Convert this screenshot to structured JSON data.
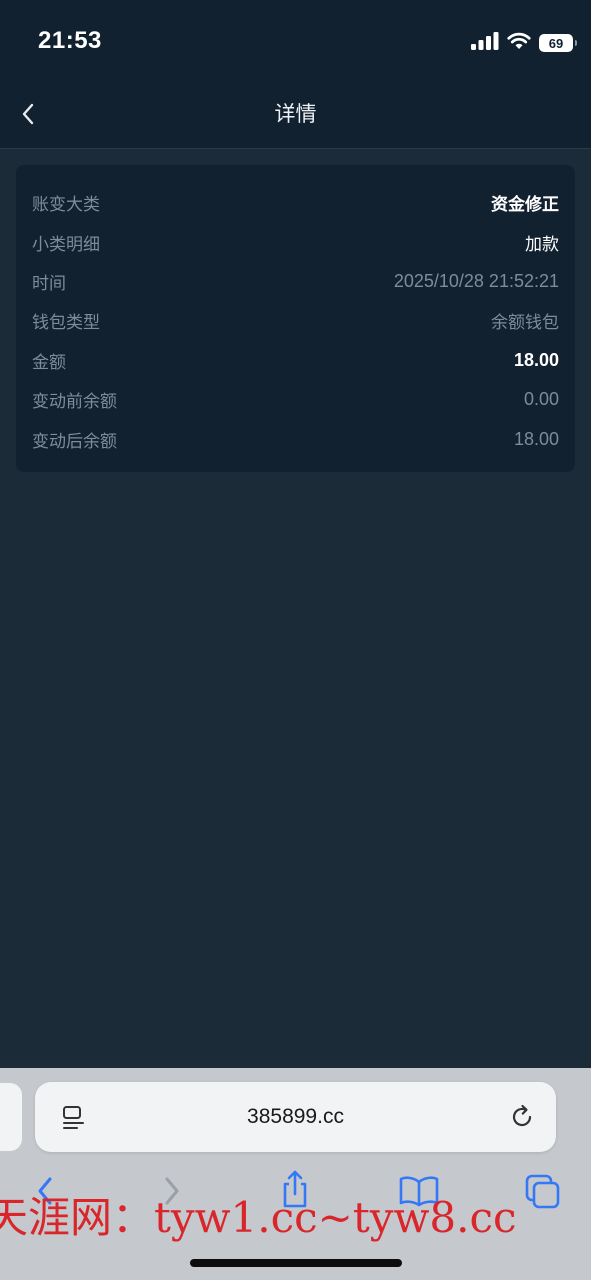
{
  "status_bar": {
    "time": "21:53",
    "battery": "69"
  },
  "nav": {
    "title": "详情"
  },
  "details": [
    {
      "label": "账变大类",
      "value": "资金修正"
    },
    {
      "label": "小类明细",
      "value": "加款"
    },
    {
      "label": "时间",
      "value": "2025/10/28 21:52:21"
    },
    {
      "label": "钱包类型",
      "value": "余额钱包"
    },
    {
      "label": "金额",
      "value": "18.00"
    },
    {
      "label": "变动前余额",
      "value": "0.00"
    },
    {
      "label": "变动后余额",
      "value": "18.00"
    }
  ],
  "browser": {
    "url": "385899.cc"
  },
  "watermark": "天涯网：tyw1.cc~tyw8.cc",
  "colors": {
    "page_bg": "#1b2b38",
    "header_bg": "#122130",
    "card_bg": "#122130",
    "muted_text": "#7d8c99",
    "toolbar_accent": "#3478f6",
    "watermark": "#d8262b"
  }
}
